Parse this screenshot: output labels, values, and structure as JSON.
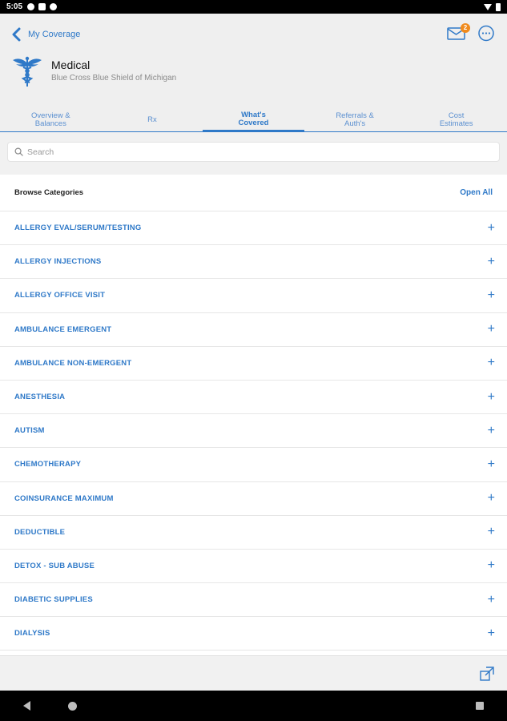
{
  "status_bar": {
    "time": "5:05"
  },
  "header": {
    "back_label": "My Coverage",
    "mail_badge": "2",
    "plan_title": "Medical",
    "plan_subtitle": "Blue Cross Blue Shield of Michigan"
  },
  "tabs": [
    {
      "line1": "Overview &",
      "line2": "Balances",
      "active": false
    },
    {
      "line1": "Rx",
      "line2": "",
      "active": false
    },
    {
      "line1": "What's",
      "line2": "Covered",
      "active": true
    },
    {
      "line1": "Referrals &",
      "line2": "Auth's",
      "active": false
    },
    {
      "line1": "Cost",
      "line2": "Estimates",
      "active": false
    }
  ],
  "search": {
    "placeholder": "Search"
  },
  "browse": {
    "label": "Browse Categories",
    "open_all": "Open All"
  },
  "categories": [
    "ALLERGY EVAL/SERUM/TESTING",
    "ALLERGY INJECTIONS",
    "ALLERGY OFFICE VISIT",
    "AMBULANCE EMERGENT",
    "AMBULANCE NON-EMERGENT",
    "ANESTHESIA",
    "AUTISM",
    "CHEMOTHERAPY",
    "COINSURANCE MAXIMUM",
    "DEDUCTIBLE",
    "DETOX - SUB ABUSE",
    "DIABETIC SUPPLIES",
    "DIALYSIS"
  ],
  "colors": {
    "accent": "#2f79c8",
    "badge": "#f08a1c"
  }
}
